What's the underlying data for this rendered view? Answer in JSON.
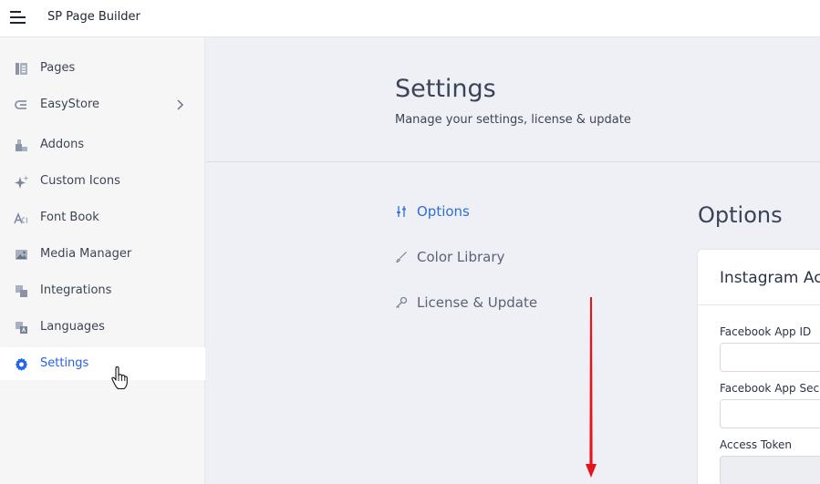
{
  "header": {
    "app_title": "SP Page Builder"
  },
  "sidebar": {
    "items": [
      {
        "label": "Pages",
        "icon": "pages-icon"
      },
      {
        "label": "EasyStore",
        "icon": "easystore-icon",
        "has_submenu": true
      },
      {
        "label": "Addons",
        "icon": "addons-icon"
      },
      {
        "label": "Custom Icons",
        "icon": "sparkle-icon"
      },
      {
        "label": "Font Book",
        "icon": "font-icon"
      },
      {
        "label": "Media Manager",
        "icon": "image-icon"
      },
      {
        "label": "Integrations",
        "icon": "integrations-icon"
      },
      {
        "label": "Languages",
        "icon": "languages-icon"
      },
      {
        "label": "Settings",
        "icon": "gear-icon",
        "active": true
      }
    ]
  },
  "main": {
    "title": "Settings",
    "subtitle": "Manage your settings, license & update",
    "nav": [
      {
        "label": "Options",
        "icon": "sliders-icon",
        "active": true
      },
      {
        "label": "Color Library",
        "icon": "brush-icon"
      },
      {
        "label": "License & Update",
        "icon": "key-icon"
      }
    ],
    "section_title": "Options",
    "card": {
      "title": "Instagram Acco",
      "fields": [
        {
          "label": "Facebook App ID",
          "value": ""
        },
        {
          "label": "Facebook App Secret",
          "value": ""
        },
        {
          "label": "Access Token",
          "value": ""
        }
      ]
    }
  },
  "colors": {
    "accent": "#2563eb",
    "annotation_arrow": "#e8131b"
  }
}
